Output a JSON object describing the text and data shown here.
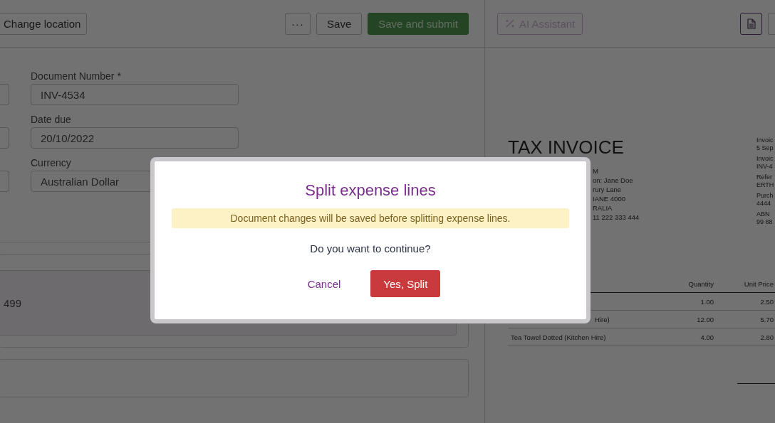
{
  "toolbar": {
    "left_button": {
      "label": "Change location"
    },
    "buttons": [
      {
        "kind": "more",
        "label": "···"
      },
      {
        "kind": "outline",
        "label": "Save"
      },
      {
        "kind": "primary",
        "label": "Save and submit",
        "disabled": true
      }
    ]
  },
  "form": {
    "fields": [
      {
        "label": "Document Number *",
        "value": "INV-4534"
      },
      {
        "label": "Date due",
        "value": "20/10/2022"
      },
      {
        "label": "Currency",
        "value": "Australian Dollar"
      }
    ]
  },
  "line_card": {
    "value": "499"
  },
  "preview": {
    "ai_button": {
      "label": "AI Assistant",
      "disabled": true
    },
    "invoice": {
      "title": "TAX INVOICE",
      "address_lines": [
        "M",
        "on: Jane Doe",
        "rury Lane",
        "IANE 4000",
        "RALIA",
        "11 222 333 444"
      ],
      "side_lines": [
        "Invoic",
        "5 Sep",
        "Invoic",
        "INV-4",
        "Refer",
        "ERTH",
        "Purch",
        "4444",
        "ABN",
        "99 88"
      ],
      "columns": [
        "Quantity",
        "Unit Price"
      ],
      "rows": [
        {
          "kind": "hidden",
          "quantity": "1.00",
          "unit_price": "2.50"
        },
        {
          "kind": "covered",
          "description": "Hire)",
          "quantity": "12.00",
          "unit_price": "5.70"
        },
        {
          "kind": "full",
          "description": "Tea Towel Dotted (Kitchen Hire)",
          "quantity": "4.00",
          "unit_price": "2.80"
        }
      ]
    }
  },
  "dialog": {
    "title": "Split expense lines",
    "warning": "Document changes will be saved before splitting expense lines.",
    "message": "Do you want to continue?",
    "cancel": "Cancel",
    "confirm": "Yes, Split"
  }
}
